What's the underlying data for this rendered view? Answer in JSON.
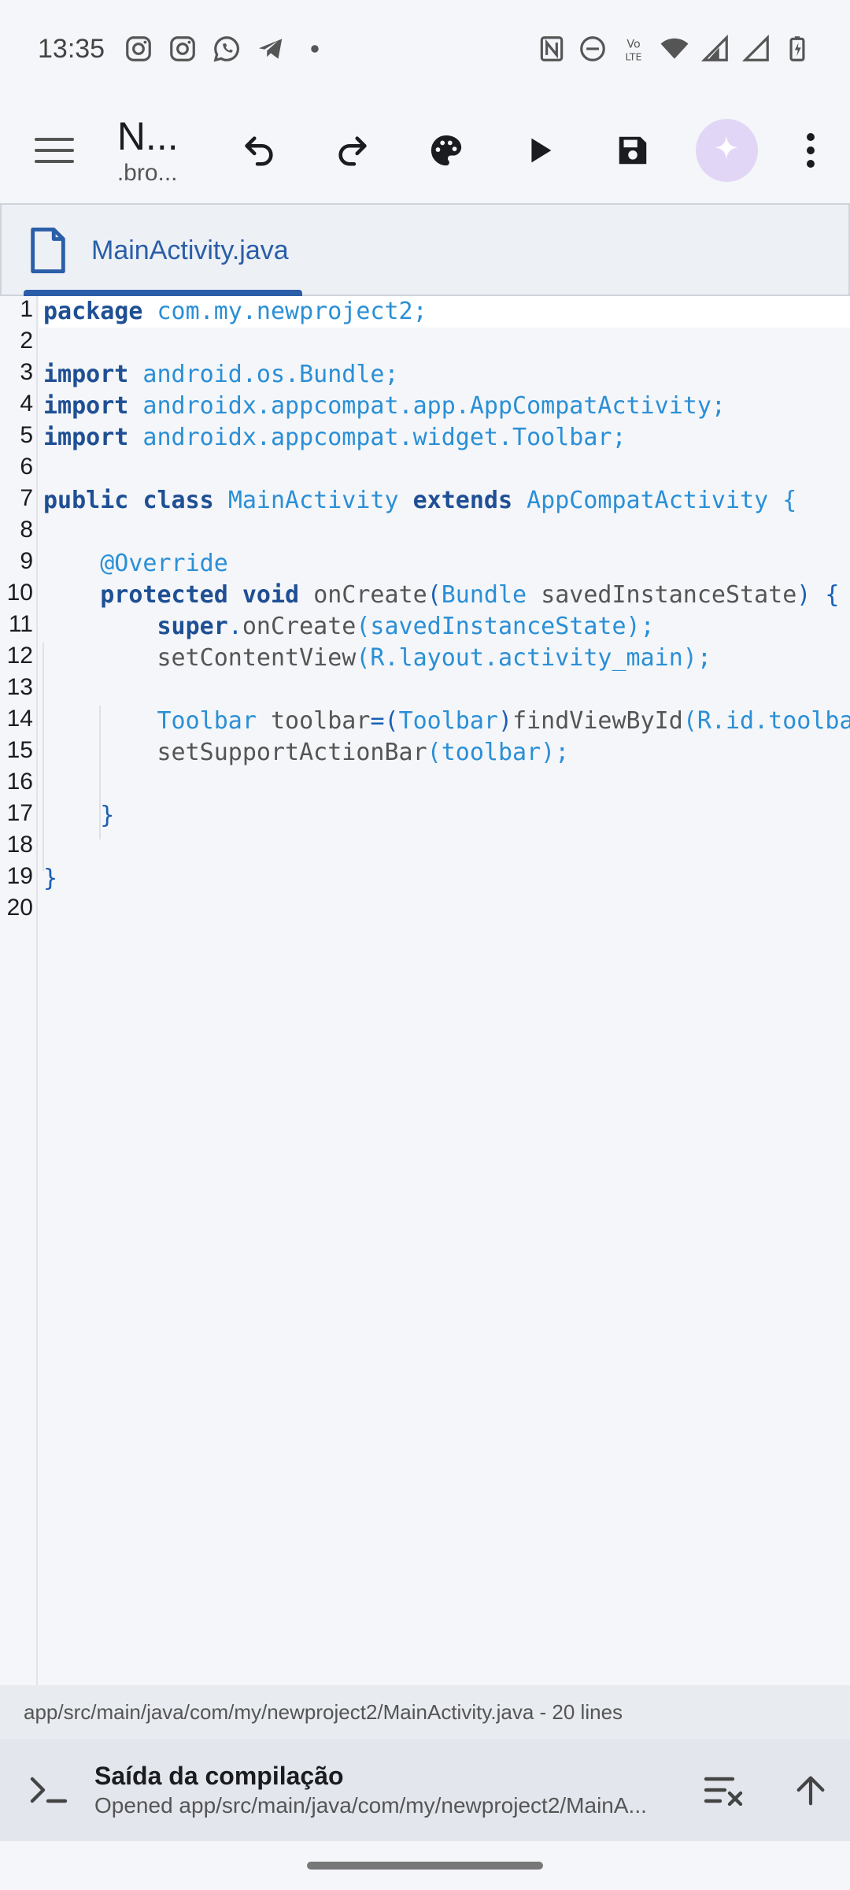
{
  "status_bar": {
    "time": "13:35"
  },
  "app_bar": {
    "project_title": "N...",
    "project_subtitle": ".bro..."
  },
  "tabs": [
    {
      "label": "MainActivity.java",
      "active": true
    }
  ],
  "editor": {
    "line_numbers": [
      "1",
      "2",
      "3",
      "4",
      "5",
      "6",
      "7",
      "8",
      "9",
      "10",
      "11",
      "12",
      "13",
      "14",
      "15",
      "16",
      "17",
      "18",
      "19",
      "20"
    ]
  },
  "path_bar": {
    "text": "app/src/main/java/com/my/newproject2/MainActivity.java - 20 lines"
  },
  "build_panel": {
    "title": "Saída da compilação",
    "subtitle": "Opened app/src/main/java/com/my/newproject2/MainA..."
  },
  "code": {
    "l1_kw": "package",
    "l1_rest": " com.my.newproject2;",
    "l3_kw": "import",
    "l3_rest": " android.os.Bundle;",
    "l4_kw": "import",
    "l4_rest": " androidx.appcompat.app.AppCompatActivity;",
    "l5_kw": "import",
    "l5_rest": " androidx.appcompat.widget.Toolbar;",
    "l7_kw1": "public",
    "l7_kw2": "class",
    "l7_cls": "MainActivity",
    "l7_kw3": "extends",
    "l7_rest": "AppCompatActivity {",
    "l9_ann": "@Override",
    "l10_kw1": "protected",
    "l10_kw2": "void",
    "l10_name": "onCreate",
    "l10_open": "(",
    "l10_type": "Bundle",
    "l10_param": "savedInstanceState",
    "l10_close": ") {",
    "l11_kw": "super",
    "l11_p1": ".",
    "l11_method": "onCreate",
    "l11_rest": "(savedInstanceState);",
    "l12_method": "setContentView",
    "l12_rest": "(R.layout.activity_main);",
    "l14_type": "Toolbar",
    "l14_var": "toolbar",
    "l14_eq": "=(",
    "l14_cast": "Toolbar",
    "l14_close": ")",
    "l14_method": "findViewById",
    "l14_rest": "(R.id.toolba",
    "l15_method": "setSupportActionBar",
    "l15_rest": "(toolbar);",
    "l17": "}",
    "l19": "}"
  },
  "colors": {
    "accent": "#2a5ea8",
    "keyword": "#1f4f94",
    "identifier": "#2a8fd6",
    "ai_button_bg": "#e2d6f7"
  }
}
